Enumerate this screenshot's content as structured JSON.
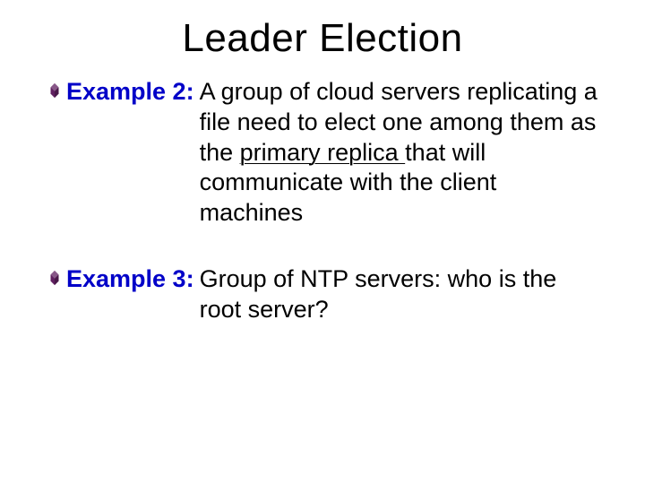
{
  "title": "Leader Election",
  "bullet_color": "#602060",
  "items": [
    {
      "label": "Example 2:",
      "pre": "A group of cloud servers replicating a file need to elect one among them as the ",
      "underlined": "primary replica ",
      "post": "that will communicate with the client machines"
    },
    {
      "label": "Example 3:",
      "pre": "Group of NTP servers: who is the root server?",
      "underlined": "",
      "post": ""
    }
  ]
}
